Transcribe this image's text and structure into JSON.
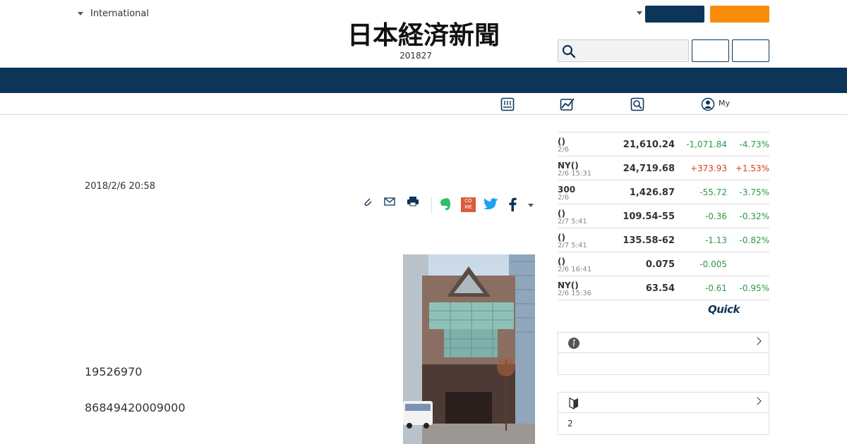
{
  "header": {
    "region_label": "International",
    "logo_text": "日本経済新聞",
    "edition_date": "201827"
  },
  "subnav": {
    "my_label": "My"
  },
  "article": {
    "timestamp": "2018/2/6 20:58",
    "paragraphs": [
      "19526970",
      "86849420009000"
    ]
  },
  "market": {
    "rows": [
      {
        "name": "()",
        "time": "2/6",
        "value": "21,610.24",
        "change": "-1,071.84",
        "pct": "-4.73%",
        "trend": "down"
      },
      {
        "name": "NY()",
        "time": "2/6 15:31",
        "value": "24,719.68",
        "change": "+373.93",
        "pct": "+1.53%",
        "trend": "up"
      },
      {
        "name": "300",
        "time": "2/6",
        "value": "1,426.87",
        "change": "-55.72",
        "pct": "-3.75%",
        "trend": "down"
      },
      {
        "name": "()",
        "time": "2/7 5:41",
        "value": "109.54-55",
        "change": "-0.36",
        "pct": "-0.32%",
        "trend": "down"
      },
      {
        "name": "()",
        "time": "2/7 5:41",
        "value": "135.58-62",
        "change": "-1.13",
        "pct": "-0.82%",
        "trend": "down"
      },
      {
        "name": "()",
        "time": "2/6 16:41",
        "value": "0.075",
        "change": "-0.005",
        "pct": "",
        "trend": "down"
      },
      {
        "name": "NY()",
        "time": "2/6 15:36",
        "value": "63.54",
        "change": "-0.61",
        "pct": "-0.95%",
        "trend": "down"
      }
    ],
    "provider": "Quick",
    "colors": {
      "up": "#d0421b",
      "down": "#2b9946"
    }
  },
  "panels": {
    "info_body": "",
    "beginner_body": "2"
  },
  "colors": {
    "navy": "#0c3558",
    "orange": "#f98c0b"
  }
}
